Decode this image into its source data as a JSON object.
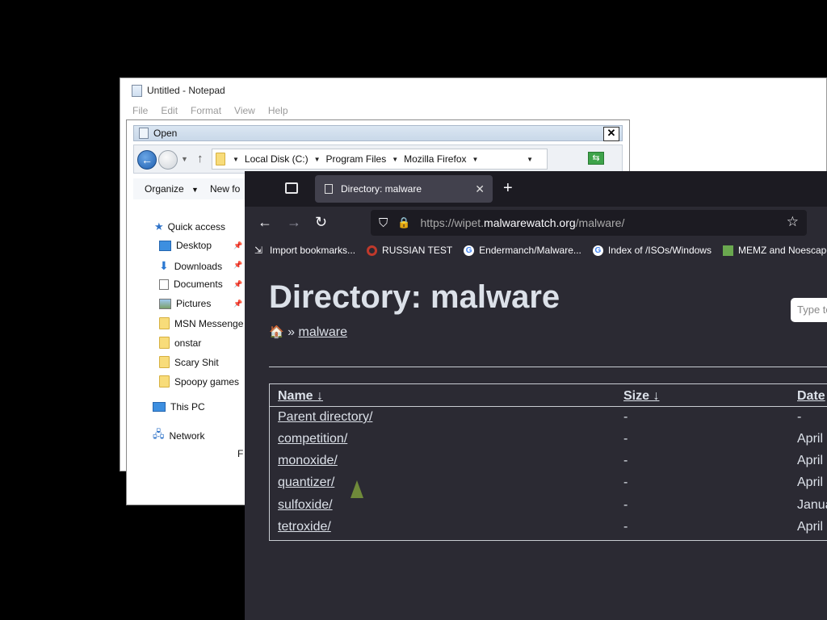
{
  "notepad": {
    "title": "Untitled - Notepad",
    "menu": [
      "File",
      "Edit",
      "Format",
      "View",
      "Help"
    ]
  },
  "open_dialog": {
    "title": "Open",
    "close": "✕",
    "path": [
      "Local Disk (C:)",
      "Program Files",
      "Mozilla Firefox"
    ],
    "toolbar": {
      "organize": "Organize",
      "new_folder": "New fo"
    },
    "tree": {
      "quick_access": "Quick access",
      "items": [
        "Desktop",
        "Downloads",
        "Documents",
        "Pictures",
        "MSN Messenge",
        "onstar",
        "Scary Shit",
        "Spoopy games"
      ],
      "this_pc": "This PC",
      "network": "Network",
      "stray": "F"
    }
  },
  "firefox": {
    "tab_title": "Directory: malware",
    "url": {
      "prefix": "https://wipet.",
      "domain": "malwarewatch.org",
      "path": "/malware/"
    },
    "bookmarks": [
      "Import bookmarks...",
      "RUSSIAN TEST",
      "Endermanch/Malware...",
      "Index of /ISOs/Windows",
      "MEMZ and Noescape ..."
    ],
    "page": {
      "heading": "Directory: malware",
      "breadcrumb_sep": "»",
      "breadcrumb_link": "malware",
      "search_placeholder": "Type to",
      "columns": {
        "name": "Name  ↓",
        "size": "Size  ↓",
        "date": "Date"
      },
      "rows": [
        {
          "name": "Parent directory/",
          "size": "-",
          "date": "-"
        },
        {
          "name": "competition/",
          "size": "-",
          "date": "April"
        },
        {
          "name": "monoxide/",
          "size": "-",
          "date": "April"
        },
        {
          "name": "quantizer/",
          "size": "-",
          "date": "April"
        },
        {
          "name": "sulfoxide/",
          "size": "-",
          "date": "Janua"
        },
        {
          "name": "tetroxide/",
          "size": "-",
          "date": "April"
        }
      ]
    }
  },
  "colors": {
    "ff_bg": "#2b2a33",
    "ff_tabstrip": "#1c1b22",
    "page_text": "#dce1e9"
  }
}
